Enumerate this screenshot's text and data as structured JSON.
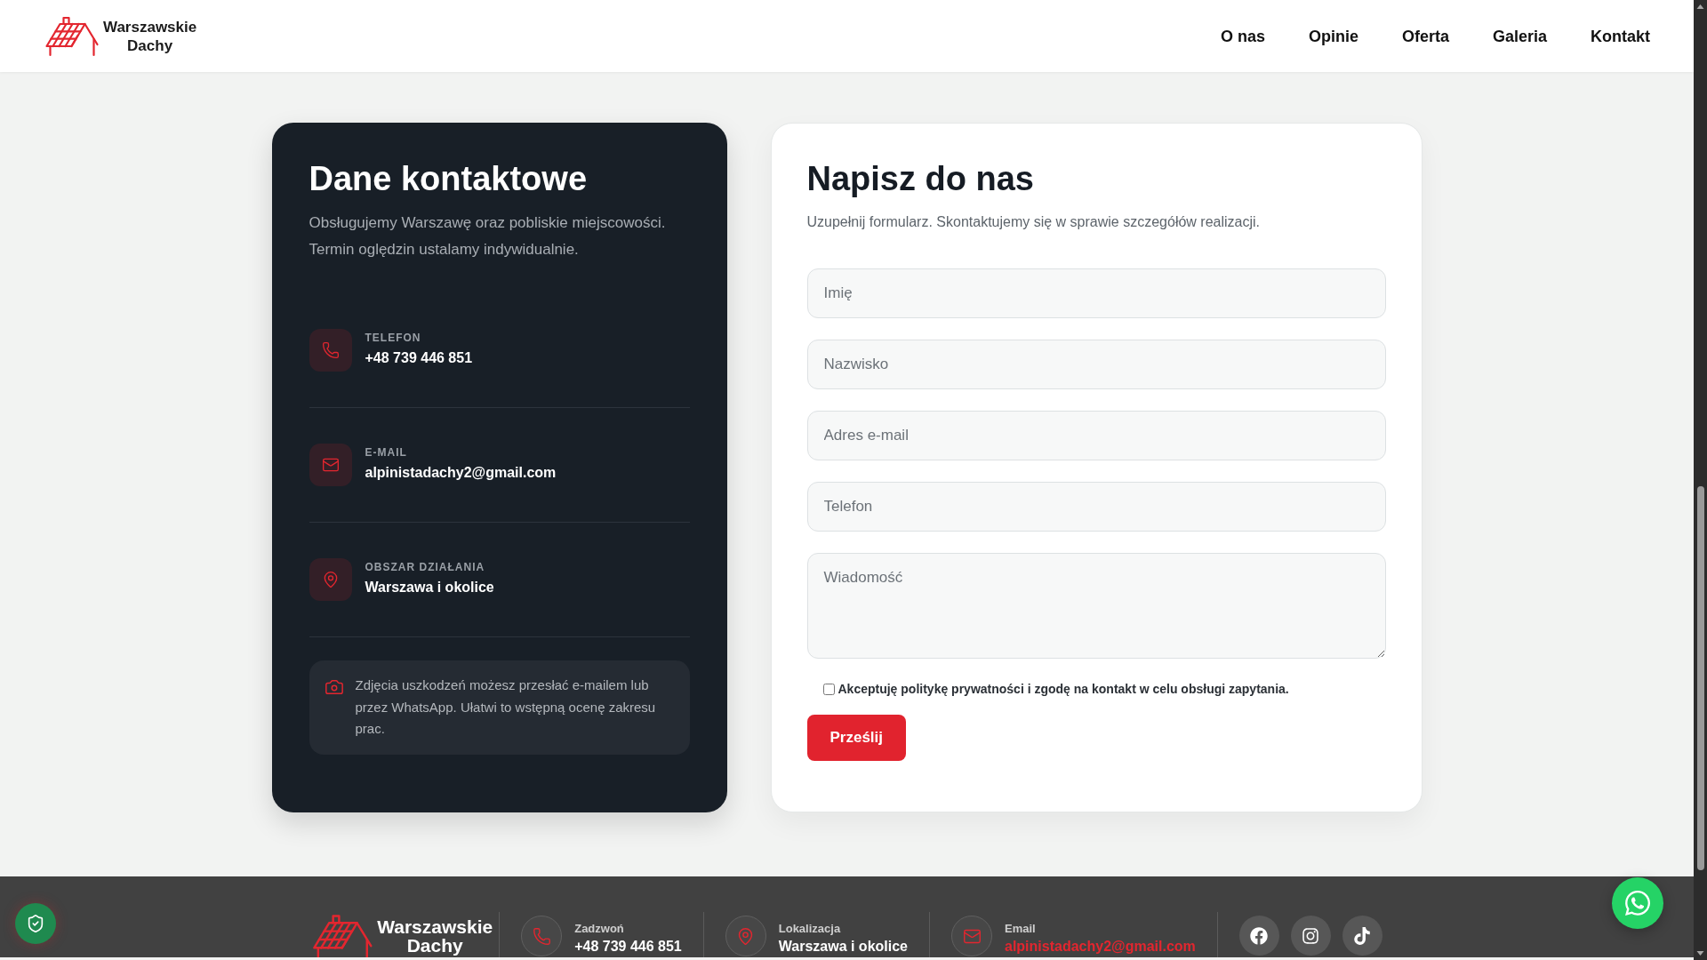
{
  "header": {
    "logo": {
      "line_1": "Warszawskie",
      "line_2": "Dachy"
    },
    "nav": [
      "O nas",
      "Opinie",
      "Oferta",
      "Galeria",
      "Kontakt"
    ]
  },
  "contact_info": {
    "title": "Dane kontaktowe",
    "description": "Obsługujemy Warszawę oraz pobliskie miejscowości. Termin oględzin ustalamy indywidualnie.",
    "items": [
      {
        "kind": "phone",
        "label": "TELEFON",
        "value": "+48 739 446 851"
      },
      {
        "kind": "email",
        "label": "E-MAIL",
        "value": "alpinistadachy2@gmail.com"
      },
      {
        "kind": "area",
        "label": "OBSZAR DZIAŁANIA",
        "value": "Warszawa i okolice"
      }
    ],
    "note": "Zdjęcia uszkodzeń możesz przesłać e-mailem lub przez WhatsApp. Ułatwi to wstępną ocenę zakresu prac."
  },
  "contact_form": {
    "title": "Napisz do nas",
    "subtitle": "Uzupełnij formularz. Skontaktujemy się w sprawie szczegółów realizacji.",
    "fields": [
      {
        "kind": "input",
        "placeholder": "Imię"
      },
      {
        "kind": "input",
        "placeholder": "Nazwisko"
      },
      {
        "kind": "input",
        "placeholder": "Adres e-mail"
      },
      {
        "kind": "input",
        "placeholder": "Telefon"
      },
      {
        "kind": "textarea",
        "placeholder": "Wiadomość"
      }
    ],
    "consent": {
      "label": "Akceptuję politykę prywatności i zgodę na kontakt w celu obsługi zapytania.",
      "checked": false
    },
    "submit": "Prześlij"
  },
  "footer": {
    "logo": {
      "line_1": "Warszawskie",
      "line_2": "Dachy"
    },
    "contacts": [
      {
        "kind": "phone",
        "label": "Zadzwoń",
        "value": "+48 739 446 851"
      },
      {
        "kind": "location",
        "label": "Lokalizacja",
        "value": "Warszawa i okolice"
      },
      {
        "kind": "email",
        "label": "Email",
        "value": "alpinistadachy2@gmail.com"
      }
    ],
    "socials": [
      {
        "kind": "facebook"
      },
      {
        "kind": "instagram"
      },
      {
        "kind": "tiktok"
      }
    ]
  }
}
